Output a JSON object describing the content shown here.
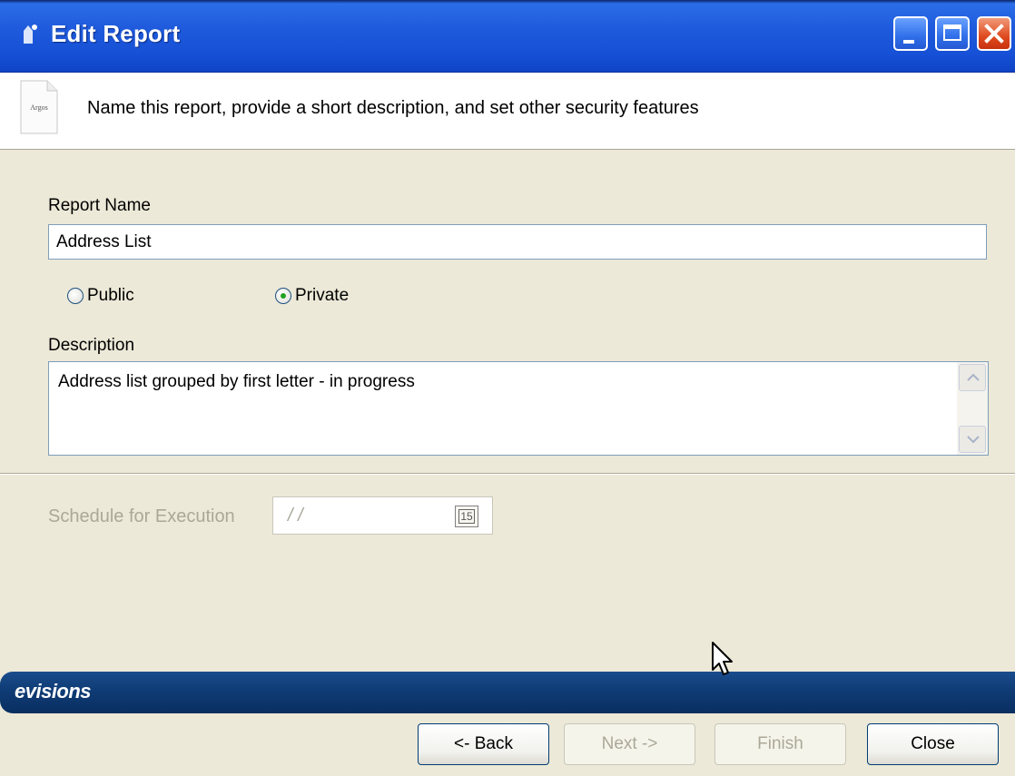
{
  "window": {
    "title": "Edit Report"
  },
  "header": {
    "icon_label": "Argos",
    "text": "Name this report, provide a short description, and set other security features"
  },
  "form": {
    "report_name_label": "Report Name",
    "report_name_value": "Address List",
    "visibility": {
      "options": [
        {
          "label": "Public",
          "checked": false
        },
        {
          "label": "Private",
          "checked": true
        }
      ]
    },
    "description_label": "Description",
    "description_value": "Address list grouped by first letter - in progress",
    "schedule_label": "Schedule for Execution",
    "schedule_value": "/ /",
    "calendar_icon_text": "15"
  },
  "brand": {
    "text": "evisions"
  },
  "buttons": {
    "back": "<- Back",
    "next": "Next ->",
    "finish": "Finish",
    "close": "Close"
  },
  "icons": {
    "title_icon": "app-icon",
    "header_icon": "report-document-icon",
    "calendar_icon": "calendar-icon",
    "cursor": "mouse-cursor-icon"
  },
  "colors": {
    "title_bar": "#1f5bdc",
    "dialog_background": "#ece9d8",
    "brand_bar": "#0e3a73",
    "radio_dot": "#21a121",
    "disabled_text": "#a9a899"
  }
}
